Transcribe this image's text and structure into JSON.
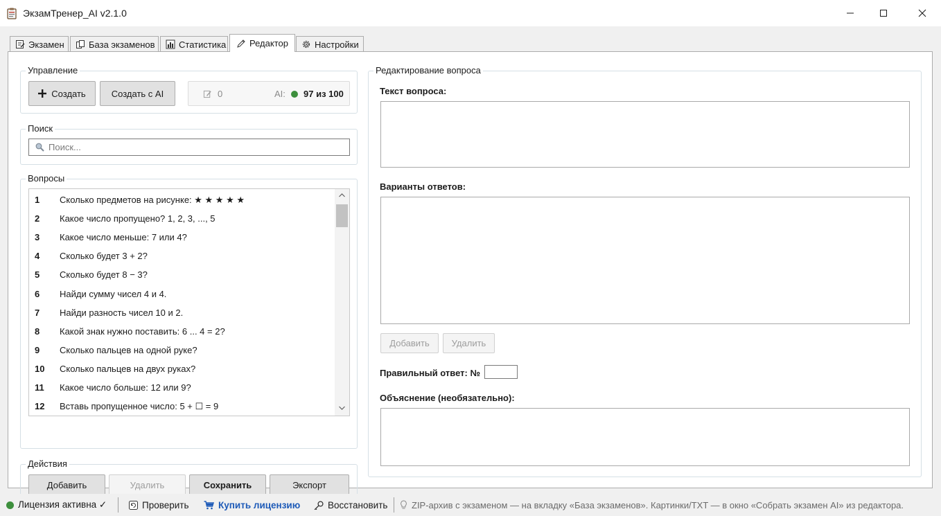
{
  "window": {
    "title": "ЭкзамТренер_AI v2.1.0"
  },
  "tabs": [
    {
      "label": "Экзамен",
      "icon": "edit-sheet-icon"
    },
    {
      "label": "База экзаменов",
      "icon": "copy-icon"
    },
    {
      "label": "Статистика",
      "icon": "bar-chart-icon"
    },
    {
      "label": "Редактор",
      "icon": "pencil-icon",
      "active": true
    },
    {
      "label": "Настройки",
      "icon": "gear-icon"
    }
  ],
  "control": {
    "group_label": "Управление",
    "create_label": "Создать",
    "create_ai_label": "Создать с AI",
    "count": "0",
    "ai_label": "AI:",
    "ai_quota": "97 из 100",
    "ai_status_color": "#3d8f3d"
  },
  "search": {
    "group_label": "Поиск",
    "placeholder": "Поиск..."
  },
  "questions": {
    "group_label": "Вопросы",
    "items": [
      {
        "num": "1",
        "text": "Сколько предметов на рисунке: ★ ★ ★ ★ ★"
      },
      {
        "num": "2",
        "text": "Какое число пропущено? 1, 2, 3, ..., 5"
      },
      {
        "num": "3",
        "text": "Какое число меньше: 7 или 4?"
      },
      {
        "num": "4",
        "text": "Сколько будет 3 + 2?"
      },
      {
        "num": "5",
        "text": "Сколько будет 8 − 3?"
      },
      {
        "num": "6",
        "text": "Найди сумму чисел 4 и 4."
      },
      {
        "num": "7",
        "text": "Найди разность чисел 10 и 2."
      },
      {
        "num": "8",
        "text": "Какой знак нужно поставить: 6 ... 4 = 2?"
      },
      {
        "num": "9",
        "text": "Сколько пальцев на одной руке?"
      },
      {
        "num": "10",
        "text": "Сколько пальцев на двух руках?"
      },
      {
        "num": "11",
        "text": "Какое число больше: 12 или 9?"
      },
      {
        "num": "12",
        "text": "Вставь пропущенное число: 5 + ☐ = 9"
      }
    ]
  },
  "actions": {
    "group_label": "Действия",
    "add_label": "Добавить",
    "delete_label": "Удалить",
    "save_label": "Сохранить",
    "export_label": "Экспорт"
  },
  "editor": {
    "group_label": "Редактирование вопроса",
    "question_text_label": "Текст вопроса:",
    "answers_label": "Варианты ответов:",
    "add_answer_label": "Добавить",
    "delete_answer_label": "Удалить",
    "correct_answer_label": "Правильный ответ: №",
    "correct_answer_value": "",
    "explanation_label": "Объяснение (необязательно):"
  },
  "statusbar": {
    "license_status": "Лицензия активна ✓",
    "license_color": "#3d8f3d",
    "check_label": "Проверить",
    "buy_label": "Купить лицензию",
    "buy_color": "#1e5bb8",
    "restore_label": "Восстановить",
    "hint": "ZIP-архив с экзаменом — на вкладку «База экзаменов». Картинки/TXT — в окно «Собрать экзамен AI» из редактора."
  }
}
